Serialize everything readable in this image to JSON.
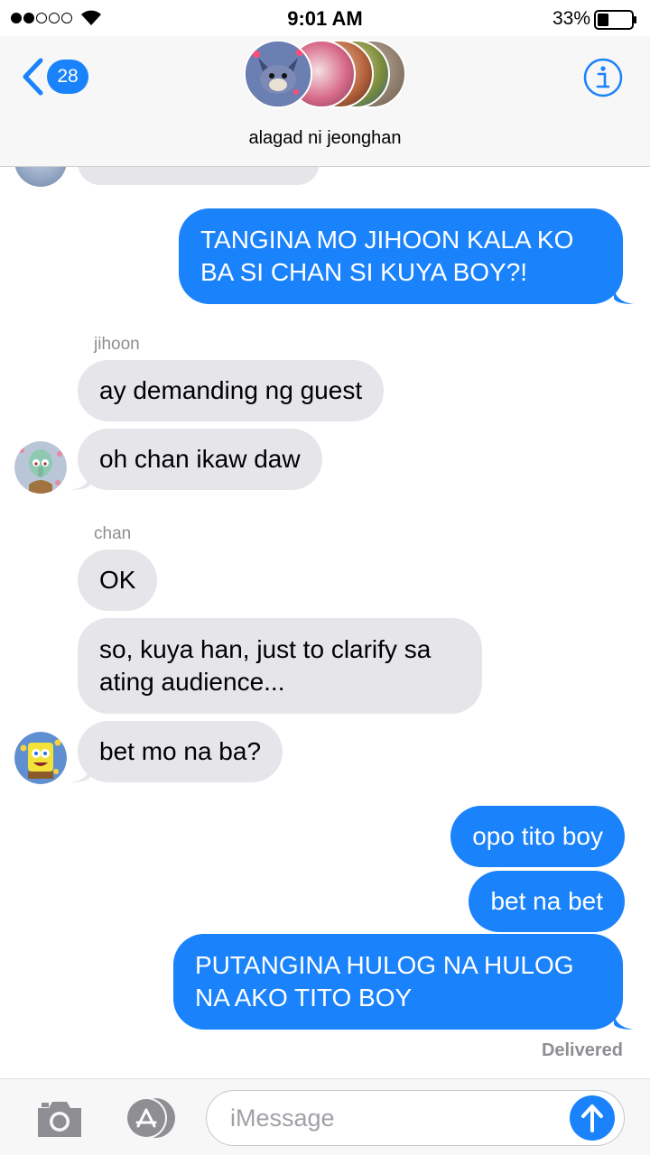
{
  "status_bar": {
    "time": "9:01 AM",
    "battery_percent": "33%",
    "battery_level": 0.33,
    "signal_bars": 2,
    "signal_total": 5
  },
  "header": {
    "back_count": "28",
    "group_name": "alagad ni jeonghan"
  },
  "colors": {
    "accent": "#1a82fb",
    "incoming_bubble": "#e5e5ea",
    "outgoing_bubble": "#1a82fb"
  },
  "messages": [
    {
      "from": "me",
      "text_lines": [
        "TANGINA MO JIHOON KALA KO",
        "BA SI CHAN SI KUYA BOY?!"
      ]
    },
    {
      "sender": "jihoon"
    },
    {
      "from": "jihoon",
      "text": "ay demanding ng guest"
    },
    {
      "from": "jihoon",
      "text": "oh chan ikaw daw"
    },
    {
      "sender": "chan"
    },
    {
      "from": "chan",
      "text": "OK"
    },
    {
      "from": "chan",
      "text_lines": [
        "so, kuya han, just to clarify sa",
        "ating audience..."
      ]
    },
    {
      "from": "chan",
      "text": "bet mo na ba?"
    },
    {
      "from": "me",
      "text": "opo tito boy"
    },
    {
      "from": "me",
      "text": "bet na bet"
    },
    {
      "from": "me",
      "text_lines": [
        "PUTANGINA HULOG NA HULOG",
        "NA AKO TITO BOY"
      ]
    }
  ],
  "delivered_label": "Delivered",
  "input": {
    "placeholder": "iMessage"
  },
  "icons": {
    "back": "chevron-left-icon",
    "info": "info-icon",
    "camera": "camera-icon",
    "apps": "app-store-icon",
    "send": "arrow-up-icon"
  }
}
